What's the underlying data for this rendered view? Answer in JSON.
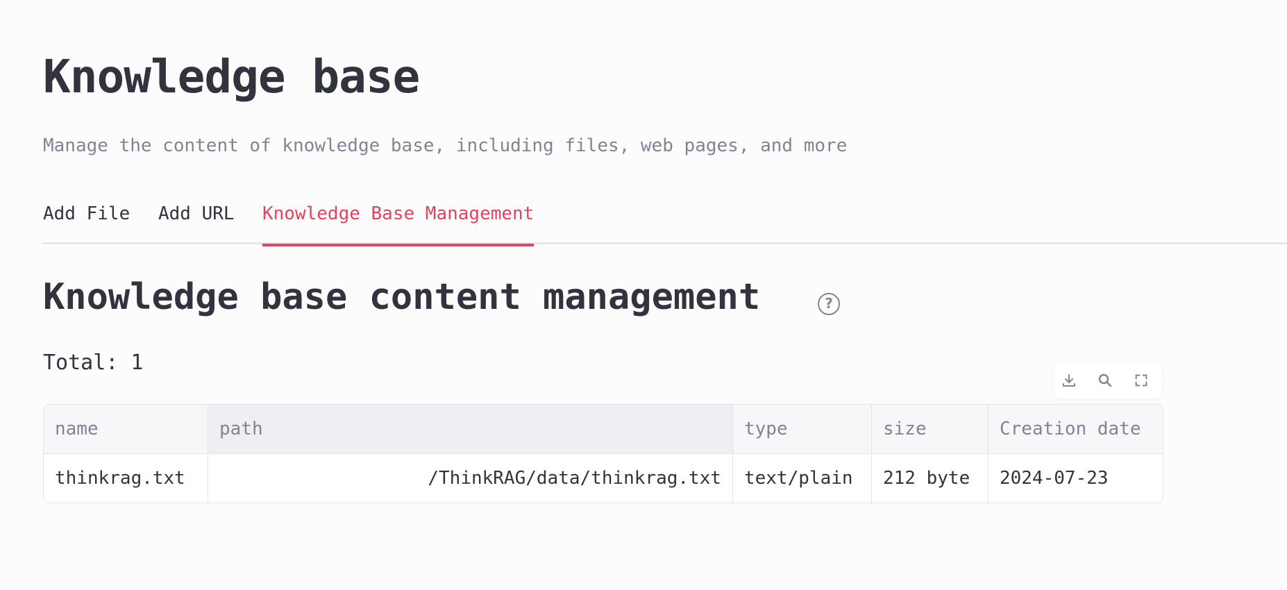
{
  "page": {
    "title": "Knowledge base",
    "subtitle": "Manage the content of knowledge base, including files, web pages, and more"
  },
  "tabs": [
    {
      "label": "Add File",
      "active": false
    },
    {
      "label": "Add URL",
      "active": false
    },
    {
      "label": "Knowledge Base Management",
      "active": true
    }
  ],
  "section": {
    "title": "Knowledge base content management",
    "help_icon": "question-circle-icon",
    "total_label": "Total: 1"
  },
  "table_toolbar": {
    "icons": [
      "download-icon",
      "search-icon",
      "fullscreen-icon"
    ]
  },
  "table": {
    "columns": [
      "name",
      "path",
      "type",
      "size",
      "Creation date"
    ],
    "rows": [
      [
        "thinkrag.txt",
        "/ThinkRAG/data/thinkrag.txt",
        "text/plain",
        "212 byte",
        "2024-07-23"
      ]
    ]
  },
  "colors": {
    "accent": "#e0445e",
    "text": "#31333f",
    "muted": "#808495",
    "background": "#fcfcfc"
  }
}
